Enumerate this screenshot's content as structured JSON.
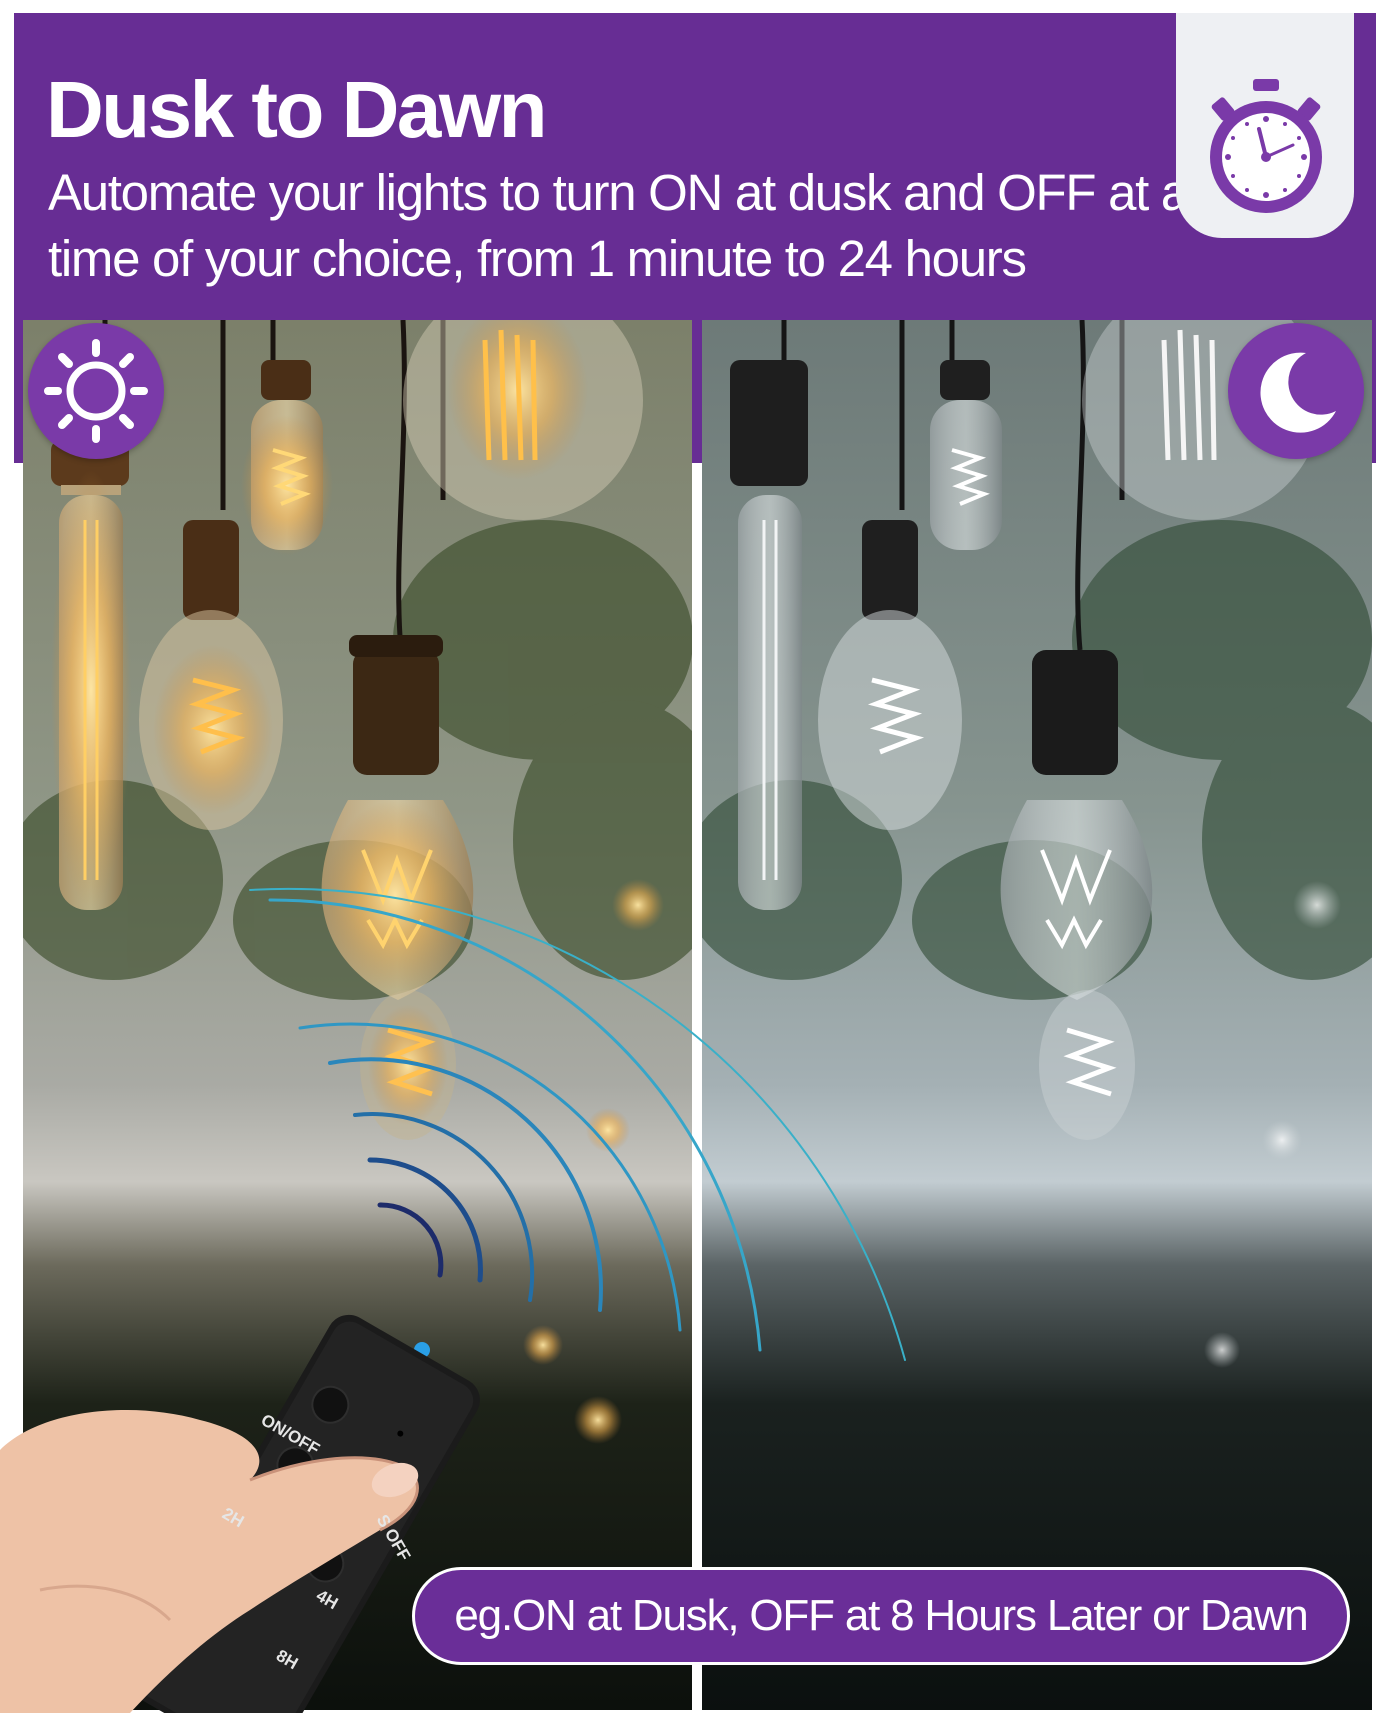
{
  "header": {
    "title": "Dusk to Dawn",
    "subtitle": "Automate your lights to turn ON at dusk and OFF at a time of your choice, from 1 minute to 24 hours"
  },
  "icons": {
    "timer": "stopwatch-icon",
    "day": "sun-icon",
    "night": "moon-icon"
  },
  "remote": {
    "labels": [
      "ON/OFF",
      "2H",
      "S OFF",
      "4H",
      "8H"
    ]
  },
  "caption": "eg.ON at Dusk, OFF at 8 Hours Later or Dawn",
  "colors": {
    "brand_purple": "#672d94",
    "signal_arcs": "#37a6c9",
    "indicator_led": "#2a9fe6",
    "timer_tab": "#eef0f3"
  }
}
